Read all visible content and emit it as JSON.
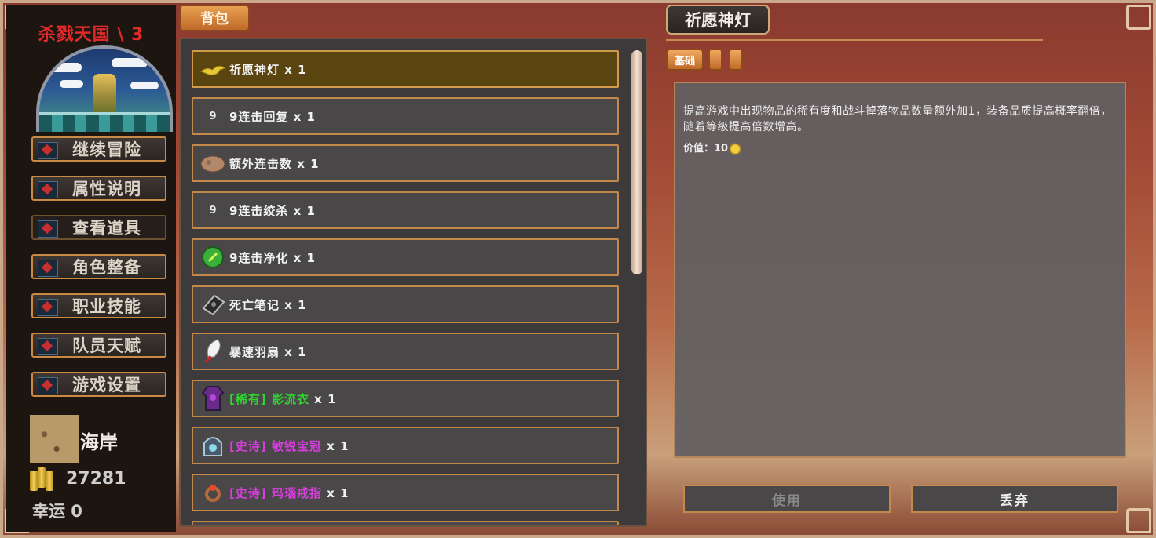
{
  "left_menu": {
    "game_title": "杀戮天国 \\ 3",
    "buttons": [
      "继续冒险",
      "属性说明",
      "查看道具",
      "角色整备",
      "职业技能",
      "队员天赋",
      "游戏设置"
    ],
    "location": "海岸",
    "gold": "27281",
    "luck": "幸运 0"
  },
  "inventory": {
    "tab_label": "背包",
    "items": [
      {
        "icon": "magic-lamp-icon",
        "prefix": "",
        "name": "祈愿神灯",
        "qty": " x 1",
        "rarity": "normal",
        "selected": true
      },
      {
        "icon": "combo-digit-icon",
        "icon_text": "9",
        "prefix": "",
        "name": "9连击回复",
        "qty": " x 1",
        "rarity": "normal"
      },
      {
        "icon": "rock-icon",
        "prefix": "",
        "name": "额外连击数",
        "qty": " x 1",
        "rarity": "normal"
      },
      {
        "icon": "combo-digit-icon",
        "icon_text": "9",
        "prefix": "",
        "name": "9连击绞杀",
        "qty": " x 1",
        "rarity": "normal"
      },
      {
        "icon": "green-orb-icon",
        "prefix": "",
        "name": "9连击净化",
        "qty": " x 1",
        "rarity": "normal"
      },
      {
        "icon": "book-icon",
        "prefix": "",
        "name": "死亡笔记",
        "qty": " x 1",
        "rarity": "normal"
      },
      {
        "icon": "feather-fan-icon",
        "prefix": "",
        "name": "暴速羽扇",
        "qty": " x 1",
        "rarity": "normal"
      },
      {
        "icon": "robe-icon",
        "prefix": "[稀有] ",
        "name": "影流衣",
        "qty": " x 1",
        "rarity": "rare"
      },
      {
        "icon": "helmet-icon",
        "prefix": "[史诗] ",
        "name": "敏锐宝冠",
        "qty": " x 1",
        "rarity": "epic"
      },
      {
        "icon": "ring-icon",
        "prefix": "[史诗] ",
        "name": "玛瑙戒指",
        "qty": " x 1",
        "rarity": "epic"
      }
    ]
  },
  "detail": {
    "title": "祈愿神灯",
    "tab_basic": "基础",
    "description": "提高游戏中出现物品的稀有度和战斗掉落物品数量额外加1，装备品质提高概率翻倍，随着等级提高倍数增高。",
    "value_label": "价值：",
    "value": "10",
    "use_button": "使用",
    "discard_button": "丢弃"
  },
  "colors": {
    "rare": "#31d431",
    "epic": "#d53fdc",
    "title_red": "#e02a2a",
    "border_orange": "#c4884a"
  }
}
